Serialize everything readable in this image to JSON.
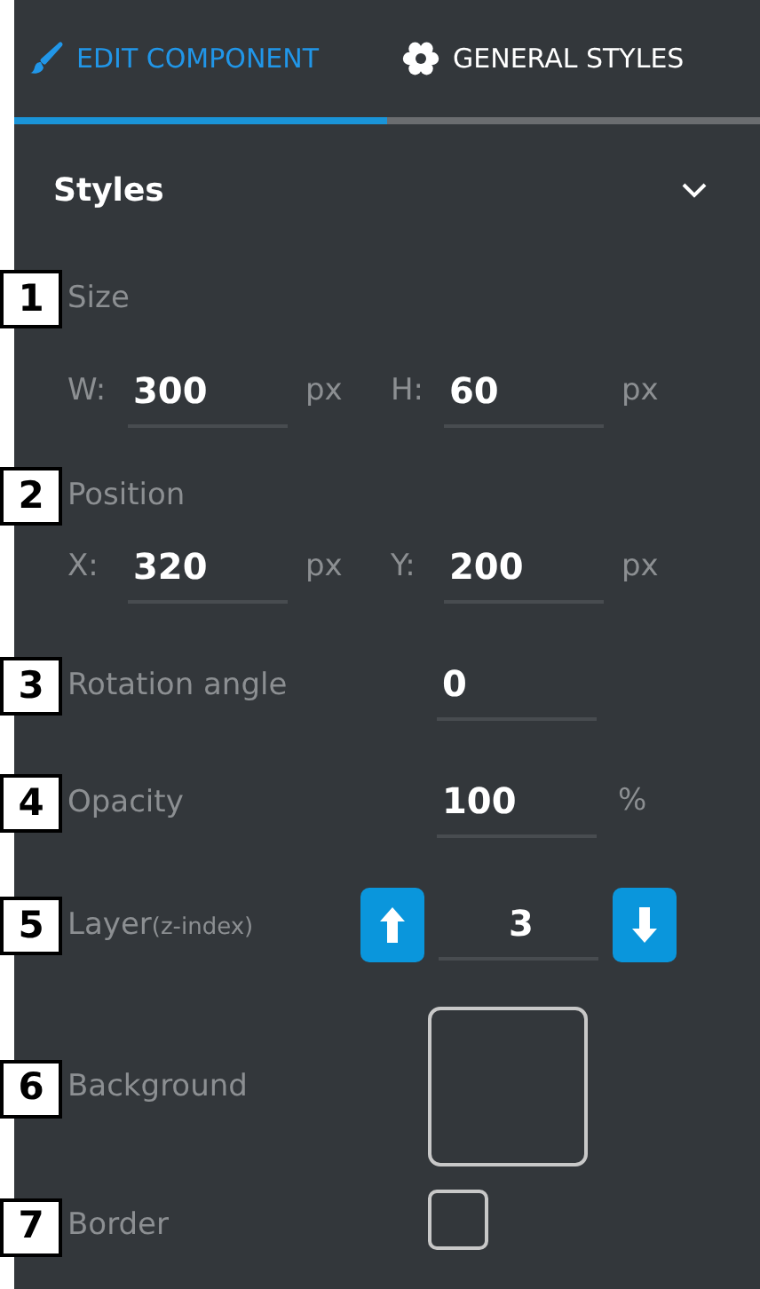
{
  "tabs": [
    {
      "label": "EDIT COMPONENT",
      "selected": true
    },
    {
      "label": "GENERAL STYLES",
      "selected": false
    }
  ],
  "section": {
    "title": "Styles",
    "expanded": true
  },
  "properties": [
    {
      "marker": "1",
      "label": "Size",
      "kind": "pair",
      "fields": [
        {
          "prefix": "W:",
          "value": "300",
          "unit": "px"
        },
        {
          "prefix": "H:",
          "value": "60",
          "unit": "px"
        }
      ]
    },
    {
      "marker": "2",
      "label": "Position",
      "kind": "pair",
      "fields": [
        {
          "prefix": "X:",
          "value": "320",
          "unit": "px"
        },
        {
          "prefix": "Y:",
          "value": "200",
          "unit": "px"
        }
      ]
    },
    {
      "marker": "3",
      "label": "Rotation angle",
      "kind": "single",
      "value": "0"
    },
    {
      "marker": "4",
      "label": "Opacity",
      "kind": "single",
      "value": "100",
      "unit": "%"
    },
    {
      "marker": "5",
      "label": "Layer",
      "note": "(z-index)",
      "kind": "stepper",
      "value": "3"
    },
    {
      "marker": "6",
      "label": "Background",
      "kind": "swatch"
    },
    {
      "marker": "7",
      "label": "Border",
      "kind": "checkbox",
      "checked": false
    }
  ]
}
